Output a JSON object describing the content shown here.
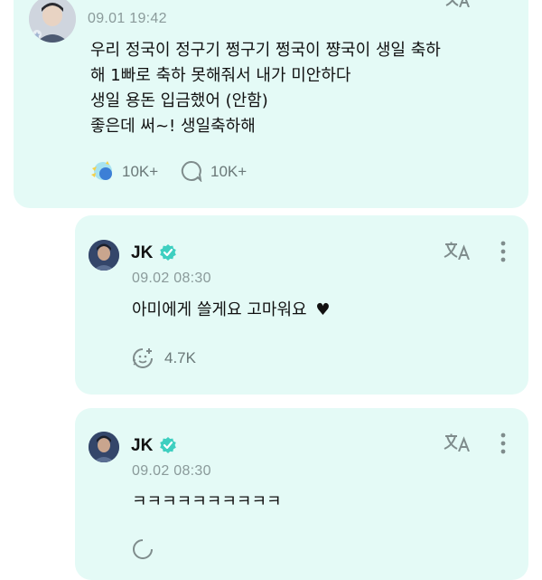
{
  "posts": [
    {
      "timestamp": "09.01 19:42",
      "lines": [
        "우리 정국이 정구기 쩡구기 쩡국이 쨩국이 생일 축하",
        "해 1빠로 축하 못해줘서 내가 미안하다",
        "생일 용돈 입금했어 (안함)",
        "좋은데 써~! 생일축하해"
      ],
      "reactions": "10K+",
      "comments": "10K+"
    },
    {
      "author": "JK",
      "timestamp": "09.02 08:30",
      "text": "아미에게 쓸게요 고마워요",
      "heart": "♥",
      "reactions": "4.7K"
    },
    {
      "author": "JK",
      "timestamp": "09.02 08:30",
      "text": "ㅋㅋㅋㅋㅋㅋㅋㅋㅋㅋ"
    }
  ],
  "colors": {
    "card_background": "#e4faf6",
    "verified_badge": "#3ecfc0",
    "muted_text": "#8a9a9a",
    "icon_gray": "#7f8c8c"
  },
  "icons": [
    "translate-icon",
    "more-vertical-icon",
    "reaction-icon",
    "comment-icon",
    "verified-badge-icon"
  ]
}
